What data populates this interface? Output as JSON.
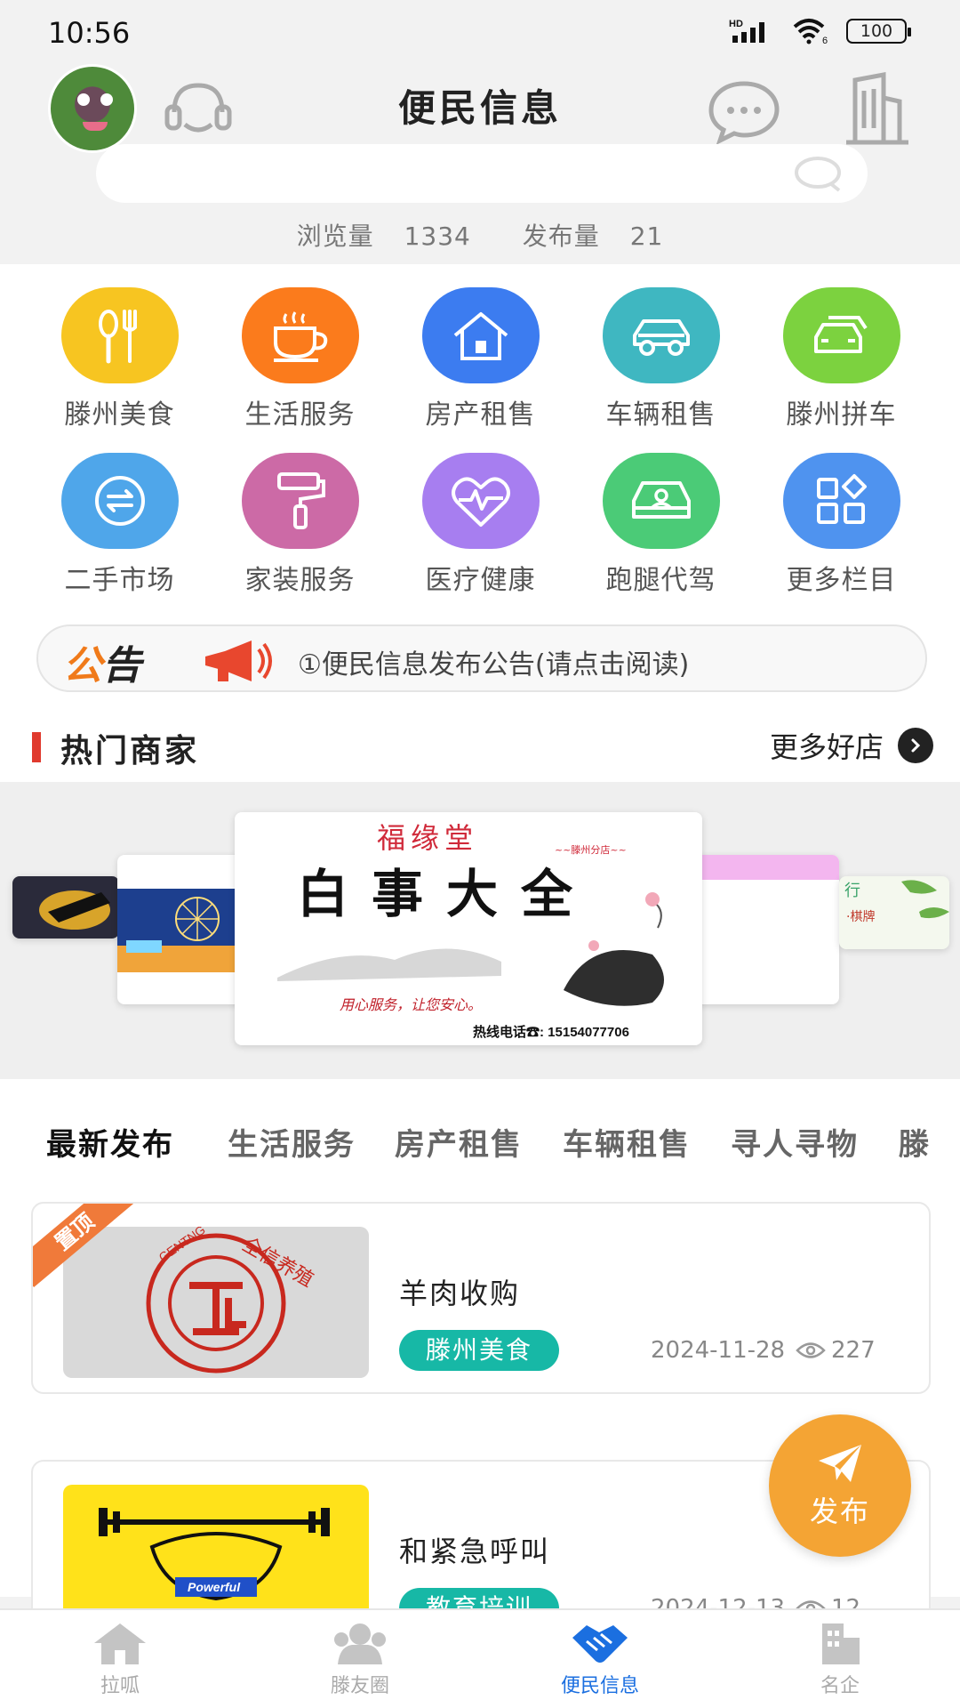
{
  "status_bar": {
    "time": "10:56",
    "hd": "HD",
    "wifi_sub": "6",
    "battery": "100"
  },
  "header": {
    "title": "便民信息",
    "search_placeholder": "",
    "stats": {
      "views_label": "浏览量",
      "views": "1334",
      "posts_label": "发布量",
      "posts": "21"
    }
  },
  "categories": [
    {
      "label": "滕州美食",
      "icon": "food-icon",
      "color": "#f7c521"
    },
    {
      "label": "生活服务",
      "icon": "coffee-icon",
      "color": "#fb7b1c"
    },
    {
      "label": "房产租售",
      "icon": "house-icon",
      "color": "#3c7cf0"
    },
    {
      "label": "车辆租售",
      "icon": "car-icon",
      "color": "#3fb7c1"
    },
    {
      "label": "滕州拼车",
      "icon": "carpool-icon",
      "color": "#7cd23f"
    },
    {
      "label": "二手市场",
      "icon": "exchange-icon",
      "color": "#4fa6ea"
    },
    {
      "label": "家装服务",
      "icon": "paint-roller-icon",
      "color": "#cc6aa6"
    },
    {
      "label": "医疗健康",
      "icon": "heart-pulse-icon",
      "color": "#a77ef0"
    },
    {
      "label": "跑腿代驾",
      "icon": "driver-icon",
      "color": "#4bcb77"
    },
    {
      "label": "更多栏目",
      "icon": "grid-icon",
      "color": "#4f93ef"
    }
  ],
  "notice": {
    "tag_a": "公",
    "tag_b": "告",
    "text": "①便民信息发布公告(请点击阅读)"
  },
  "hot_merchants": {
    "title": "热门商家",
    "more": "更多好店",
    "featured": {
      "brand": "福缘堂",
      "branch": "~~滕州分店~~",
      "headline": "白事大全",
      "slogan": "用心服务，让您安心。",
      "hotline": "热线电话☎: 15154077706"
    },
    "side_text": "行",
    "side_text2": "·棋牌"
  },
  "tabs": [
    "最新发布",
    "生活服务",
    "房产租售",
    "车辆租售",
    "寻人寻物",
    "滕"
  ],
  "posts": [
    {
      "pin": "置顶",
      "title": "羊肉收购",
      "tag": "滕州美食",
      "date": "2024-11-28",
      "views": "227",
      "img_text": "GENTNG",
      "img_brand": "全信养殖"
    },
    {
      "title": "和紧急呼叫",
      "tag": "教育培训",
      "date": "2024-12-13",
      "views": "12",
      "img_text": "Powerful"
    }
  ],
  "fab": {
    "label": "发布"
  },
  "bottom_nav": [
    {
      "label": "拉呱",
      "icon": "home-icon",
      "active": false
    },
    {
      "label": "滕友圈",
      "icon": "friends-icon",
      "active": false
    },
    {
      "label": "便民信息",
      "icon": "handshake-icon",
      "active": true
    },
    {
      "label": "名企",
      "icon": "building-icon",
      "active": false
    }
  ],
  "colors": {
    "accent": "#1b6fe0",
    "fab": "#f4a434",
    "tag": "#17b8a6",
    "ribbon": "#f07a3a",
    "marker": "#e03a2e"
  }
}
